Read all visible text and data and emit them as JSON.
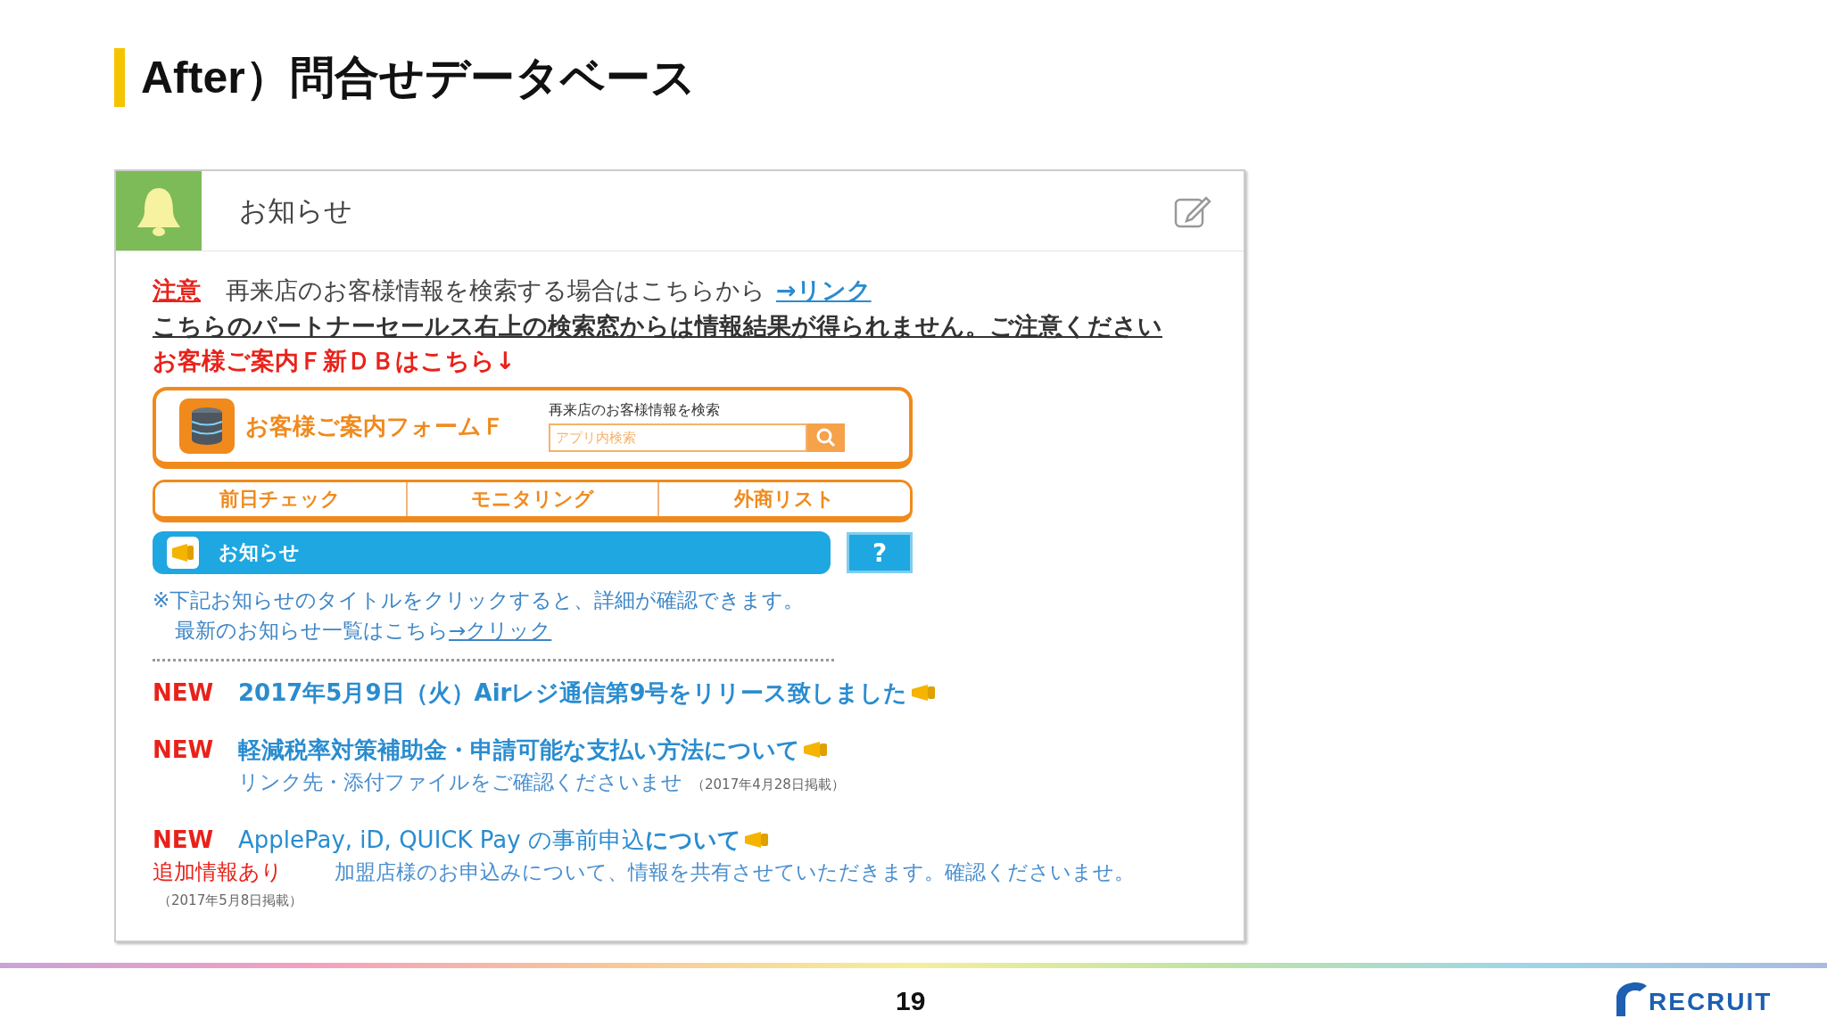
{
  "slide": {
    "title": "After）問合せデータベース",
    "page_number": "19",
    "logo": "RECRUIT"
  },
  "panel": {
    "title": "お知らせ"
  },
  "notice": {
    "label": "注意",
    "text": "再来店のお客様情報を検索する場合はこちらから",
    "link": "→リンク",
    "warning": "こちらのパートナーセールス右上の検索窓からは情報結果が得られません。ご注意ください",
    "pointer": "お客様ご案内Ｆ新ＤＢはこちら↓"
  },
  "form_banner": {
    "title": "お客様ご案内フォームＦ",
    "search_label": "再来店のお客様情報を検索",
    "placeholder": "アプリ内検索"
  },
  "nav_tabs": [
    "前日チェック",
    "モニタリング",
    "外商リスト"
  ],
  "news_bar": {
    "title": "お知らせ",
    "help": "?"
  },
  "hint": {
    "line1": "※下記お知らせのタイトルをクリックすると、詳細が確認できます。",
    "line2": "最新のお知らせ一覧はこちら",
    "link": "→クリック"
  },
  "news": [
    {
      "badge": "NEW",
      "title": "2017年5月9日（火）Airレジ通信第9号をリリース致しました",
      "bold": true
    },
    {
      "badge": "NEW",
      "title": "軽減税率対策補助金・申請可能な支払い方法について",
      "bold": true,
      "note": "リンク先・添付ファイルをご確認くださいませ",
      "date": "（2017年4月28日掲載）"
    },
    {
      "badge": "NEW",
      "title": "ApplePay, iD, QUICK Pay の事前申込**について**",
      "bold": false,
      "tag": "追加情報あり",
      "note": "加盟店様のお申込みについて、情報を共有させていただきます。確認くださいませ。",
      "date": "（2017年5月8日掲載）"
    }
  ]
}
